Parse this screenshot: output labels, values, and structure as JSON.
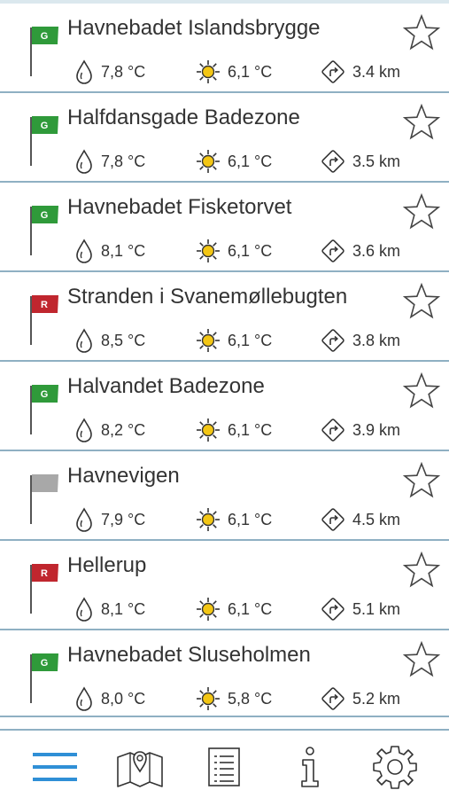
{
  "colors": {
    "flag_green": "#2f9a3a",
    "flag_red": "#c0262e",
    "flag_grey": "#a8a8a8",
    "divider": "#8fb0c3",
    "tab_active": "#2f8fd6",
    "sun": "#f3c614"
  },
  "beaches": [
    {
      "name": "Havnebadet Islandsbrygge",
      "flag": "G",
      "flag_color": "green",
      "water_temp": "7,8 °C",
      "air_temp": "6,1 °C",
      "distance": "3.4 km"
    },
    {
      "name": "Halfdansgade Badezone",
      "flag": "G",
      "flag_color": "green",
      "water_temp": "7,8 °C",
      "air_temp": "6,1 °C",
      "distance": "3.5 km"
    },
    {
      "name": "Havnebadet Fisketorvet",
      "flag": "G",
      "flag_color": "green",
      "water_temp": "8,1 °C",
      "air_temp": "6,1 °C",
      "distance": "3.6 km"
    },
    {
      "name": "Stranden i Svanemøllebugten",
      "flag": "R",
      "flag_color": "red",
      "water_temp": "8,5 °C",
      "air_temp": "6,1 °C",
      "distance": "3.8 km"
    },
    {
      "name": "Halvandet Badezone",
      "flag": "G",
      "flag_color": "green",
      "water_temp": "8,2 °C",
      "air_temp": "6,1 °C",
      "distance": "3.9 km"
    },
    {
      "name": "Havnevigen",
      "flag": "",
      "flag_color": "grey",
      "water_temp": "7,9 °C",
      "air_temp": "6,1 °C",
      "distance": "4.5 km"
    },
    {
      "name": "Hellerup",
      "flag": "R",
      "flag_color": "red",
      "water_temp": "8,1 °C",
      "air_temp": "6,1 °C",
      "distance": "5.1 km"
    },
    {
      "name": "Havnebadet Sluseholmen",
      "flag": "G",
      "flag_color": "green",
      "water_temp": "8,0 °C",
      "air_temp": "5,8 °C",
      "distance": "5.2 km"
    }
  ],
  "tabbar": {
    "tabs": [
      {
        "icon": "menu-icon",
        "active": true
      },
      {
        "icon": "map-pin-icon",
        "active": false
      },
      {
        "icon": "list-icon",
        "active": false
      },
      {
        "icon": "info-icon",
        "active": false
      },
      {
        "icon": "gear-icon",
        "active": false
      }
    ]
  }
}
